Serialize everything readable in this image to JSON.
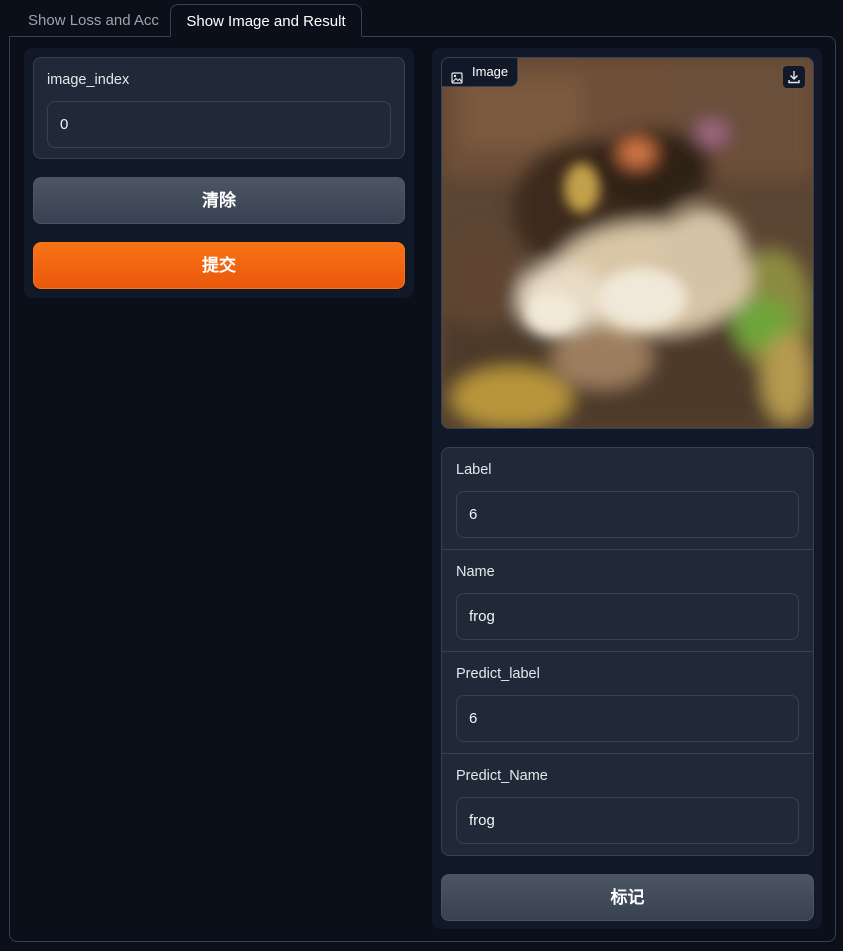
{
  "tabs": [
    {
      "label": "Show Loss and Acc",
      "active": false
    },
    {
      "label": "Show Image and Result",
      "active": true
    }
  ],
  "input": {
    "label": "image_index",
    "value": "0"
  },
  "buttons": {
    "clear": "清除",
    "submit": "提交",
    "flag": "标记"
  },
  "image": {
    "label": "Image",
    "icon": "image-icon",
    "download_icon": "download-icon"
  },
  "outputs": {
    "label": {
      "title": "Label",
      "value": "6"
    },
    "name": {
      "title": "Name",
      "value": "frog"
    },
    "predict_label": {
      "title": "Predict_label",
      "value": "6"
    },
    "predict_name": {
      "title": "Predict_Name",
      "value": "frog"
    }
  },
  "colors": {
    "background": "#0b0f19",
    "panel": "#111827",
    "field": "#1f2937",
    "border": "#374151",
    "primary": "#f97316",
    "secondary": "#4b5563"
  }
}
